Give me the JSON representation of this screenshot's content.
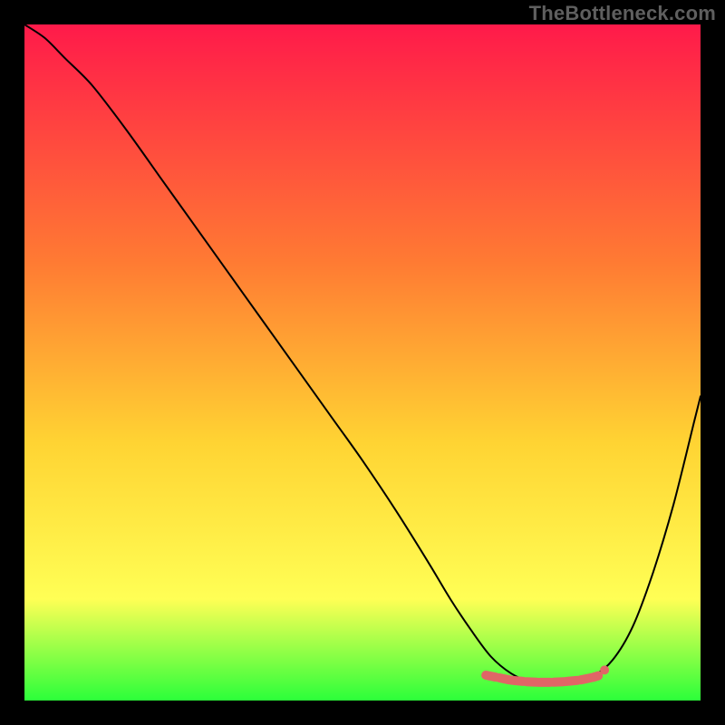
{
  "watermark": "TheBottleneck.com",
  "colors": {
    "background": "#000000",
    "gradient_top": "#ff1a4a",
    "gradient_mid1": "#ff7a33",
    "gradient_mid2": "#ffd433",
    "gradient_mid3": "#ffff55",
    "gradient_bottom": "#2bff3a",
    "curve": "#000000",
    "marker": "#e06666",
    "watermark": "#5f5f5f"
  },
  "chart_data": {
    "type": "line",
    "title": "",
    "xlabel": "",
    "ylabel": "",
    "xlim": [
      0,
      100
    ],
    "ylim": [
      0,
      100
    ],
    "legend": false,
    "grid": false,
    "series": [
      {
        "name": "bottleneck-curve",
        "x": [
          0,
          3,
          6,
          10,
          15,
          20,
          25,
          30,
          35,
          40,
          45,
          50,
          55,
          60,
          63,
          66,
          69,
          72,
          75,
          78,
          81,
          84,
          87,
          90,
          93,
          96,
          99,
          100
        ],
        "y": [
          100,
          98,
          95,
          91,
          84.5,
          77.5,
          70.5,
          63.5,
          56.5,
          49.5,
          42.5,
          35.5,
          28,
          20,
          15,
          10.5,
          6.5,
          4,
          2.7,
          2.3,
          2.5,
          3.5,
          6,
          11,
          19,
          29,
          41,
          45
        ]
      }
    ],
    "markers": [
      {
        "name": "low-bottleneck-highlight",
        "x": [
          68,
          70,
          72,
          74,
          76,
          78,
          80,
          82,
          84,
          85
        ],
        "y": [
          3.8,
          3.4,
          3.0,
          2.8,
          2.7,
          2.7,
          2.8,
          3.0,
          3.4,
          3.7
        ],
        "color": "#e06666"
      }
    ],
    "annotations": []
  }
}
